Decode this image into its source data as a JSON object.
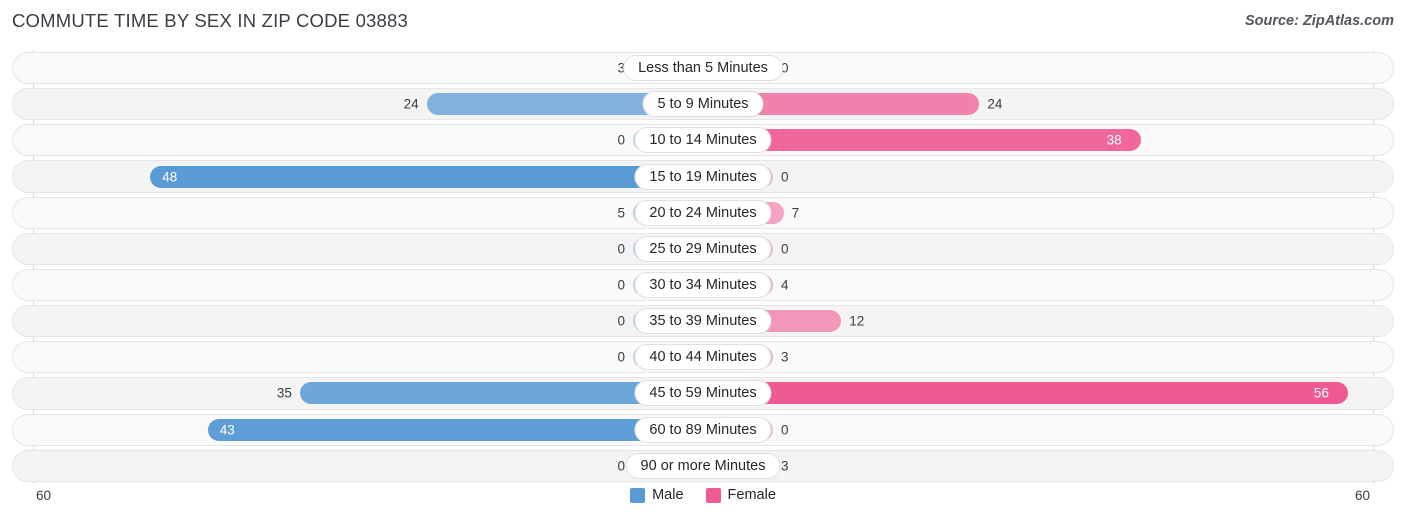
{
  "header": {
    "title": "COMMUTE TIME BY SEX IN ZIP CODE 03883",
    "source": "Source: ZipAtlas.com"
  },
  "legend": {
    "items": [
      {
        "label": "Male",
        "color": "#5b9bd5"
      },
      {
        "label": "Female",
        "color": "#ef5a92"
      }
    ]
  },
  "axis": {
    "left_max_label": "60",
    "right_max_label": "60"
  },
  "chart_data": {
    "type": "bar",
    "subtype": "diverging-horizontal-bar",
    "title": "COMMUTE TIME BY SEX IN ZIP CODE 03883",
    "xlabel": "",
    "ylabel": "",
    "xlim": [
      60,
      60
    ],
    "axis_max": 60,
    "grid": true,
    "legend_position": "bottom-center",
    "categories": [
      "Less than 5 Minutes",
      "5 to 9 Minutes",
      "10 to 14 Minutes",
      "15 to 19 Minutes",
      "20 to 24 Minutes",
      "25 to 29 Minutes",
      "30 to 34 Minutes",
      "35 to 39 Minutes",
      "40 to 44 Minutes",
      "45 to 59 Minutes",
      "60 to 89 Minutes",
      "90 or more Minutes"
    ],
    "series": [
      {
        "name": "Male",
        "color": "#5b9bd5",
        "direction": "left",
        "values": [
          3,
          24,
          0,
          48,
          5,
          0,
          0,
          0,
          0,
          35,
          43,
          0
        ]
      },
      {
        "name": "Female",
        "color": "#ef5a92",
        "direction": "right",
        "values": [
          0,
          24,
          38,
          0,
          7,
          0,
          4,
          12,
          3,
          56,
          0,
          3
        ]
      }
    ]
  }
}
